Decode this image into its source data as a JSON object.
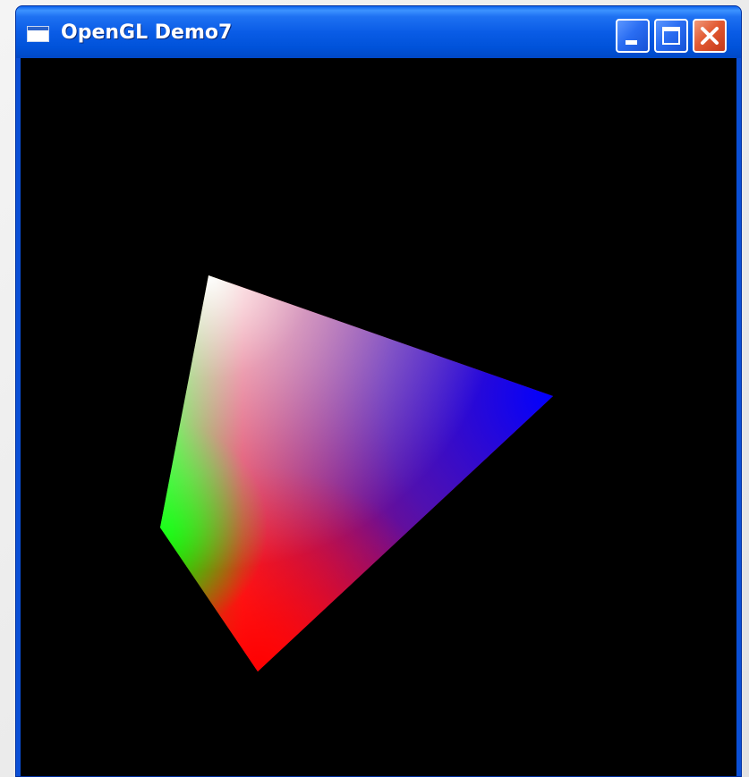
{
  "window": {
    "title": "OpenGL Demo7",
    "icon": "application-window-icon",
    "buttons": {
      "minimize": "minimize-icon",
      "maximize": "maximize-icon",
      "close": "close-icon"
    }
  },
  "viewport": {
    "background": "#000000",
    "triangle_colors": {
      "top": "#ffffff",
      "left_gradient": "#00ff00",
      "right": "#0000ff",
      "bottom": "#ff0000"
    }
  }
}
